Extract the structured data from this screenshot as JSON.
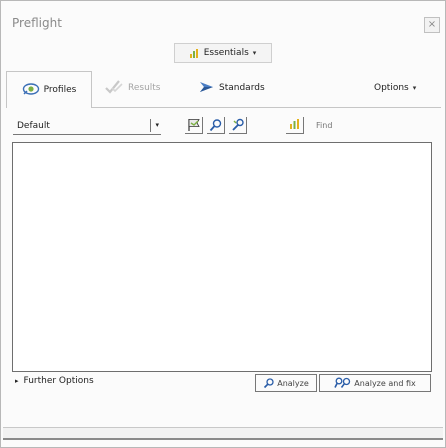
{
  "window": {
    "title": "Preflight",
    "close_glyph": "×"
  },
  "workspace": {
    "label": "Essentials",
    "caret": "▾",
    "icon": "bar-chart-icon"
  },
  "tabs": [
    {
      "label": "Profiles",
      "icon": "profiles-icon",
      "active": true
    },
    {
      "label": "Results",
      "icon": "results-checkmark-icon",
      "active": false
    },
    {
      "label": "Standards",
      "icon": "standards-icon",
      "active": false
    }
  ],
  "options": {
    "label": "Options",
    "caret": "▾"
  },
  "toolbar": {
    "profile_value": "Default",
    "select_arrow": "▾",
    "find_placeholder": "Find"
  },
  "further_options": {
    "label": "Further Options",
    "toggle_glyph": "▸"
  },
  "actions": {
    "analyze_label": "Analyze",
    "analyze_fix_label": "Analyze and fix"
  },
  "colors": {
    "accent_green": "#7bb043",
    "accent_yellow": "#e3b21b",
    "icon_blue": "#3b6fb6",
    "border": "#6e6e6e"
  }
}
